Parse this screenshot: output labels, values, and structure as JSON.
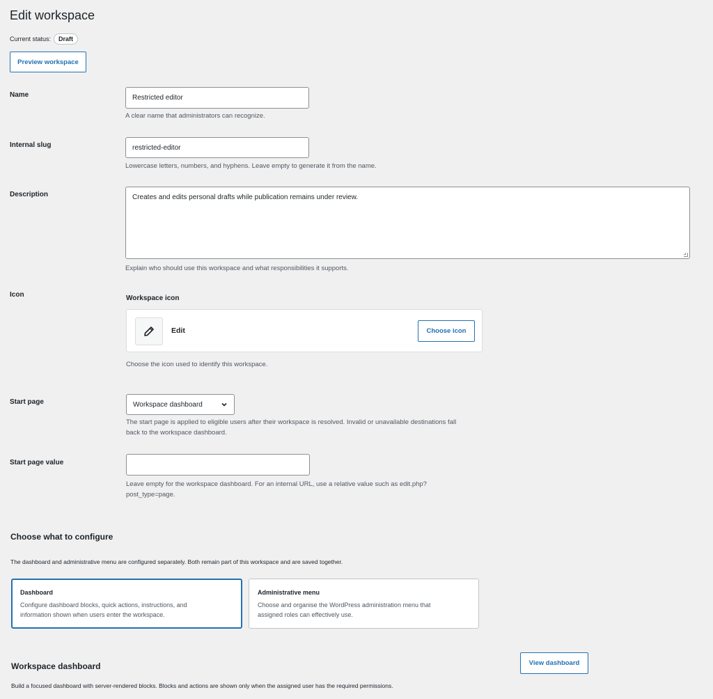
{
  "header": {
    "title": "Edit workspace",
    "status_label": "Current status:",
    "status_badge": "Draft",
    "preview_button": "Preview workspace"
  },
  "fields": {
    "name": {
      "label": "Name",
      "value": "Restricted editor",
      "help": "A clear name that administrators can recognize."
    },
    "slug": {
      "label": "Internal slug",
      "value": "restricted-editor",
      "help": "Lowercase letters, numbers, and hyphens. Leave empty to generate it from the name."
    },
    "description": {
      "label": "Description",
      "value": "Creates and edits personal drafts while publication remains under review.",
      "help": "Explain who should use this workspace and what responsibilities it supports."
    },
    "icon": {
      "label": "Icon",
      "sublabel": "Workspace icon",
      "icon_name": "pencil-icon",
      "value": "Edit",
      "choose_button": "Choose icon",
      "help": "Choose the icon used to identify this workspace."
    },
    "start_page": {
      "label": "Start page",
      "selected": "Workspace dashboard",
      "help_line1": "The start page is applied to eligible users after their workspace is resolved. Invalid or unavailable destinations fall",
      "help_line2": "back to the workspace dashboard."
    },
    "start_page_value": {
      "label": "Start page value",
      "value": "",
      "help_line1": "Leave empty for the workspace dashboard. For an internal URL, use a relative value such as edit.php?",
      "help_line2": "post_type=page."
    }
  },
  "configure": {
    "heading": "Choose what to configure",
    "intro": "The dashboard and administrative menu are configured separately. Both remain part of this workspace and are saved together.",
    "options": [
      {
        "title": "Dashboard",
        "desc_line1": "Configure dashboard blocks, quick actions, instructions, and",
        "desc_line2": "information shown when users enter the workspace.",
        "selected": true
      },
      {
        "title": "Administrative menu",
        "desc_line1": "Choose and organise the WordPress administration menu that",
        "desc_line2": "assigned roles can effectively use.",
        "selected": false
      }
    ]
  },
  "dashboard": {
    "heading": "Workspace dashboard",
    "view_button": "View dashboard",
    "intro": "Build a focused dashboard with server-rendered blocks. Blocks and actions are shown only when the assigned user has the required permissions."
  },
  "colors": {
    "accent": "#2271b1",
    "background": "#f0f0f1",
    "text": "#1d2327",
    "muted": "#50575e"
  }
}
